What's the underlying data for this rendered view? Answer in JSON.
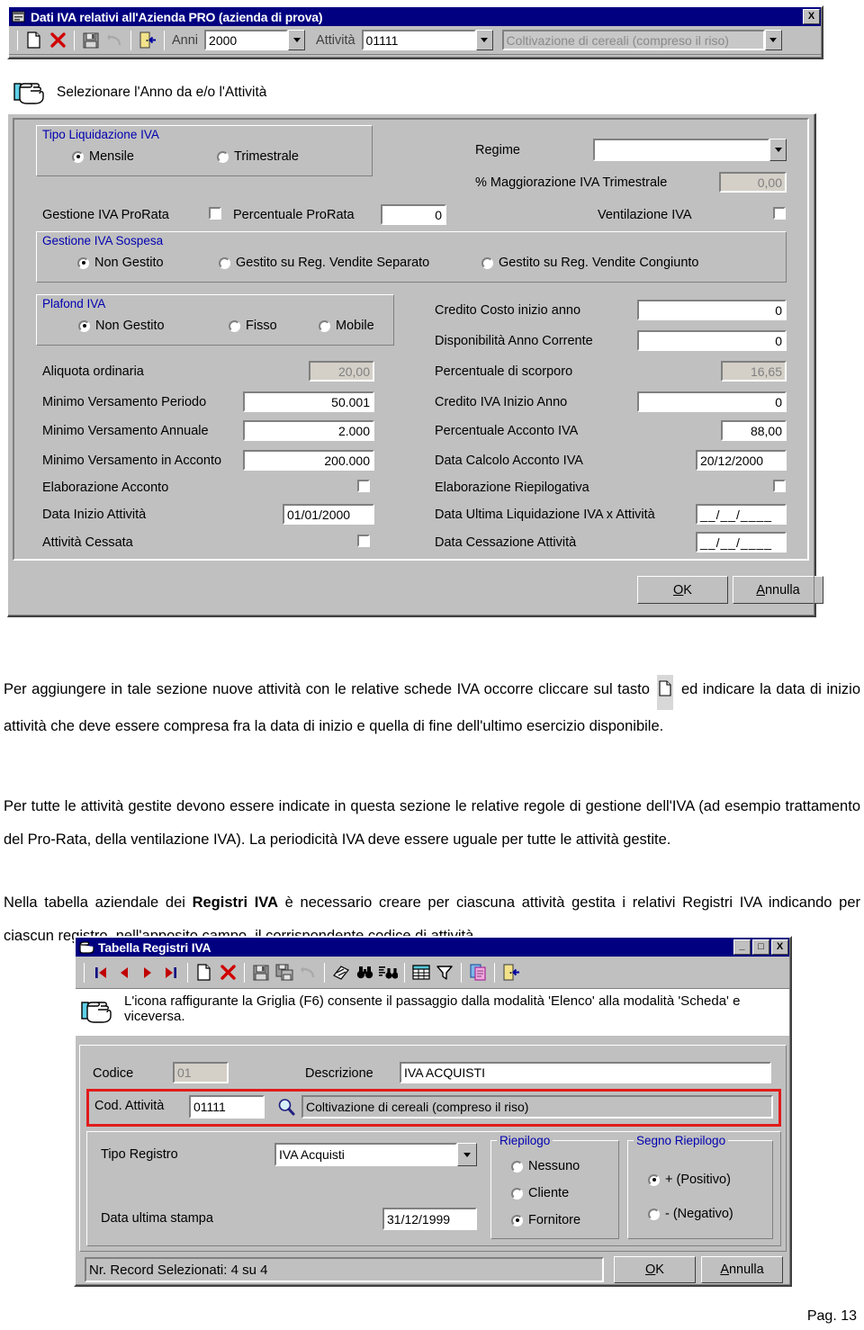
{
  "dialog1": {
    "title": "Dati IVA relativi all'Azienda PRO (azienda di prova)",
    "close_label": "X",
    "toolbar": {
      "icons": [
        "new-document-icon",
        "delete-red-x-icon",
        "save-disk-icon",
        "undo-arrow-icon",
        "exit-door-icon"
      ],
      "anni_label": "Anni",
      "anni_value": "2000",
      "attivita_label": "Attività",
      "attivita_value": "01111",
      "attivita_desc": "Coltivazione di cereali (compreso il riso)"
    },
    "hint": "Selezionare l'Anno da e/o l'Attività",
    "tipo_liquidazione": {
      "legend": "Tipo Liquidazione IVA",
      "options": [
        "Mensile",
        "Trimestrale"
      ],
      "selected": "Mensile"
    },
    "prorata": {
      "label": "Gestione IVA ProRata",
      "checkbox_checked": false,
      "percent_label": "Percentuale ProRata",
      "percent_value": "0"
    },
    "regime": {
      "label": "Regime",
      "value": "",
      "maggiorazione_label": "% Maggiorazione IVA Trimestrale",
      "maggiorazione_value": "0,00",
      "ventilazione_label": "Ventilazione IVA",
      "ventilazione_checked": false
    },
    "iva_sospesa": {
      "legend": "Gestione IVA Sospesa",
      "options": [
        "Non Gestito",
        "Gestito su Reg. Vendite Separato",
        "Gestito su Reg. Vendite Congiunto"
      ],
      "selected": "Non Gestito"
    },
    "plafond": {
      "legend": "Plafond IVA",
      "options": [
        "Non Gestito",
        "Fisso",
        "Mobile"
      ],
      "selected": "Non Gestito"
    },
    "left_fields": [
      {
        "label": "Aliquota ordinaria",
        "value": "20,00",
        "readonly": true
      },
      {
        "label": "Minimo Versamento Periodo",
        "value": "50.001",
        "readonly": false
      },
      {
        "label": "Minimo Versamento Annuale",
        "value": "2.000",
        "readonly": false
      },
      {
        "label": "Minimo Versamento in Acconto",
        "value": "200.000",
        "readonly": false
      }
    ],
    "elaborazione_acconto": {
      "label": "Elaborazione Acconto",
      "checked": false
    },
    "data_inizio": {
      "label": "Data Inizio Attività",
      "value": "01/01/2000"
    },
    "attivita_cessata": {
      "label": "Attività Cessata",
      "checked": false
    },
    "right_fields": [
      {
        "label": "Credito Costo inizio anno",
        "value": "0",
        "readonly": false
      },
      {
        "label": "Disponibilità Anno Corrente",
        "value": "0",
        "readonly": false
      },
      {
        "label": "Percentuale di scorporo",
        "value": "16,65",
        "readonly": true
      },
      {
        "label": "Credito IVA Inizio Anno",
        "value": "0",
        "readonly": false
      },
      {
        "label": "Percentuale Acconto IVA",
        "value": "88,00",
        "readonly": false
      }
    ],
    "data_calcolo_acconto": {
      "label": "Data Calcolo Acconto IVA",
      "value": "20/12/2000"
    },
    "elaborazione_riepilogativa": {
      "label": "Elaborazione Riepilogativa",
      "checked": false
    },
    "data_ultima_liq": {
      "label": "Data Ultima Liquidazione IVA x Attività",
      "value": "__/__/____"
    },
    "data_cessazione": {
      "label": "Data Cessazione Attività",
      "value": "__/__/____"
    },
    "ok_label": "OK",
    "cancel_label": "Annulla"
  },
  "body_text": {
    "p1_a": "Per aggiungere in tale sezione nuove attività con le relative schede IVA occorre cliccare  sul tasto",
    "p1_icon": "new-document-icon",
    "p1_b": "ed indicare la data di inizio attività che deve essere compresa fra la data di inizio e quella di fine dell'ultimo esercizio disponibile.",
    "p2": "Per tutte le attività gestite devono essere indicate in questa sezione le relative regole di gestione dell'IVA (ad esempio trattamento del Pro-Rata, della ventilazione IVA). La periodicità IVA deve essere uguale per tutte le attività gestite.",
    "p3_a": "Nella tabella aziendale dei",
    "p3_bold": "Registri IVA",
    "p3_b": "è necessario creare per ciascuna attività gestita i relativi Registri IVA indicando per ciascun registro, nell'apposito campo, il corrispondente codice di attività."
  },
  "dialog2": {
    "title": "Tabella Registri IVA",
    "minimize_label": "_",
    "maximize_label": "□",
    "close_label": "X",
    "toolbar_icons": [
      "first-record-icon",
      "previous-record-icon",
      "next-record-icon",
      "last-record-icon",
      "new-document-icon",
      "delete-red-x-icon",
      "save-disk-icon",
      "save-all-disk-icon",
      "undo-arrow-icon",
      "sort-icon",
      "find-binoculars-icon",
      "find-next-binoculars-icon",
      "grid-table-icon",
      "filter-funnel-icon",
      "copy-pages-icon",
      "exit-door-icon"
    ],
    "hint": "L'icona raffigurante la Griglia (F6) consente il passaggio dalla modalità 'Elenco' alla modalità 'Scheda' e viceversa.",
    "codice": {
      "label": "Codice",
      "value": "01"
    },
    "descrizione": {
      "label": "Descrizione",
      "value": "IVA ACQUISTI"
    },
    "cod_attivita": {
      "label": "Cod. Attività",
      "value": "01111",
      "search_icon": "magnifier-icon",
      "desc": "Coltivazione di cereali (compreso il riso)",
      "highlight_color": "#e01b1b"
    },
    "tipo_registro": {
      "label": "Tipo Registro",
      "value": "IVA Acquisti"
    },
    "data_ultima_stampa": {
      "label": "Data ultima stampa",
      "value": "31/12/1999"
    },
    "riepilogo": {
      "legend": "Riepilogo",
      "options": [
        "Nessuno",
        "Cliente",
        "Fornitore"
      ],
      "selected": "Fornitore"
    },
    "segno_riepilogo": {
      "legend": "Segno Riepilogo",
      "options": [
        "+ (Positivo)",
        "- (Negativo)"
      ],
      "selected": "+ (Positivo)"
    },
    "status": "Nr. Record Selezionati: 4 su 4",
    "ok_label": "OK",
    "cancel_label": "Annulla"
  },
  "footer": {
    "page_label": "Pag. 13"
  }
}
